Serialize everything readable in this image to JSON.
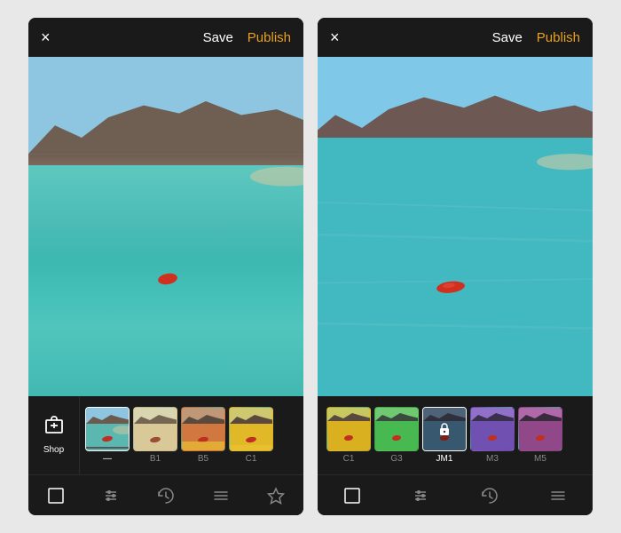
{
  "app": {
    "background_color": "#e8e8e8"
  },
  "panels": [
    {
      "id": "left",
      "header": {
        "close_label": "×",
        "save_label": "Save",
        "publish_label": "Publish"
      },
      "bottom_toolbar": {
        "icons": [
          "frame-icon",
          "sliders-icon",
          "history-icon",
          "menu-icon",
          "star-icon"
        ]
      },
      "filter_strip": {
        "shop_label": "Shop",
        "filters": [
          {
            "id": "none",
            "label": "",
            "selected": true,
            "thumb_class": "thumb-none"
          },
          {
            "id": "B1",
            "label": "B1",
            "selected": false,
            "thumb_class": "thumb-b1"
          },
          {
            "id": "B5",
            "label": "B5",
            "selected": false,
            "thumb_class": "thumb-b5"
          },
          {
            "id": "C1",
            "label": "C1",
            "selected": false,
            "thumb_class": "thumb-c1"
          }
        ]
      }
    },
    {
      "id": "right",
      "header": {
        "close_label": "×",
        "save_label": "Save",
        "publish_label": "Publish"
      },
      "bottom_toolbar": {
        "icons": [
          "frame-icon",
          "sliders-icon",
          "history-icon",
          "menu-icon"
        ]
      },
      "filter_strip": {
        "filters": [
          {
            "id": "C1",
            "label": "C1",
            "selected": false,
            "thumb_class": "thumb-c1b"
          },
          {
            "id": "G3",
            "label": "G3",
            "selected": false,
            "thumb_class": "thumb-g3"
          },
          {
            "id": "JM1",
            "label": "JM1",
            "selected": true,
            "thumb_class": "thumb-jm1",
            "locked": true
          },
          {
            "id": "M3",
            "label": "M3",
            "selected": false,
            "thumb_class": "thumb-m3"
          },
          {
            "id": "M5",
            "label": "M5",
            "selected": false,
            "thumb_class": "thumb-m5"
          }
        ]
      }
    }
  ]
}
